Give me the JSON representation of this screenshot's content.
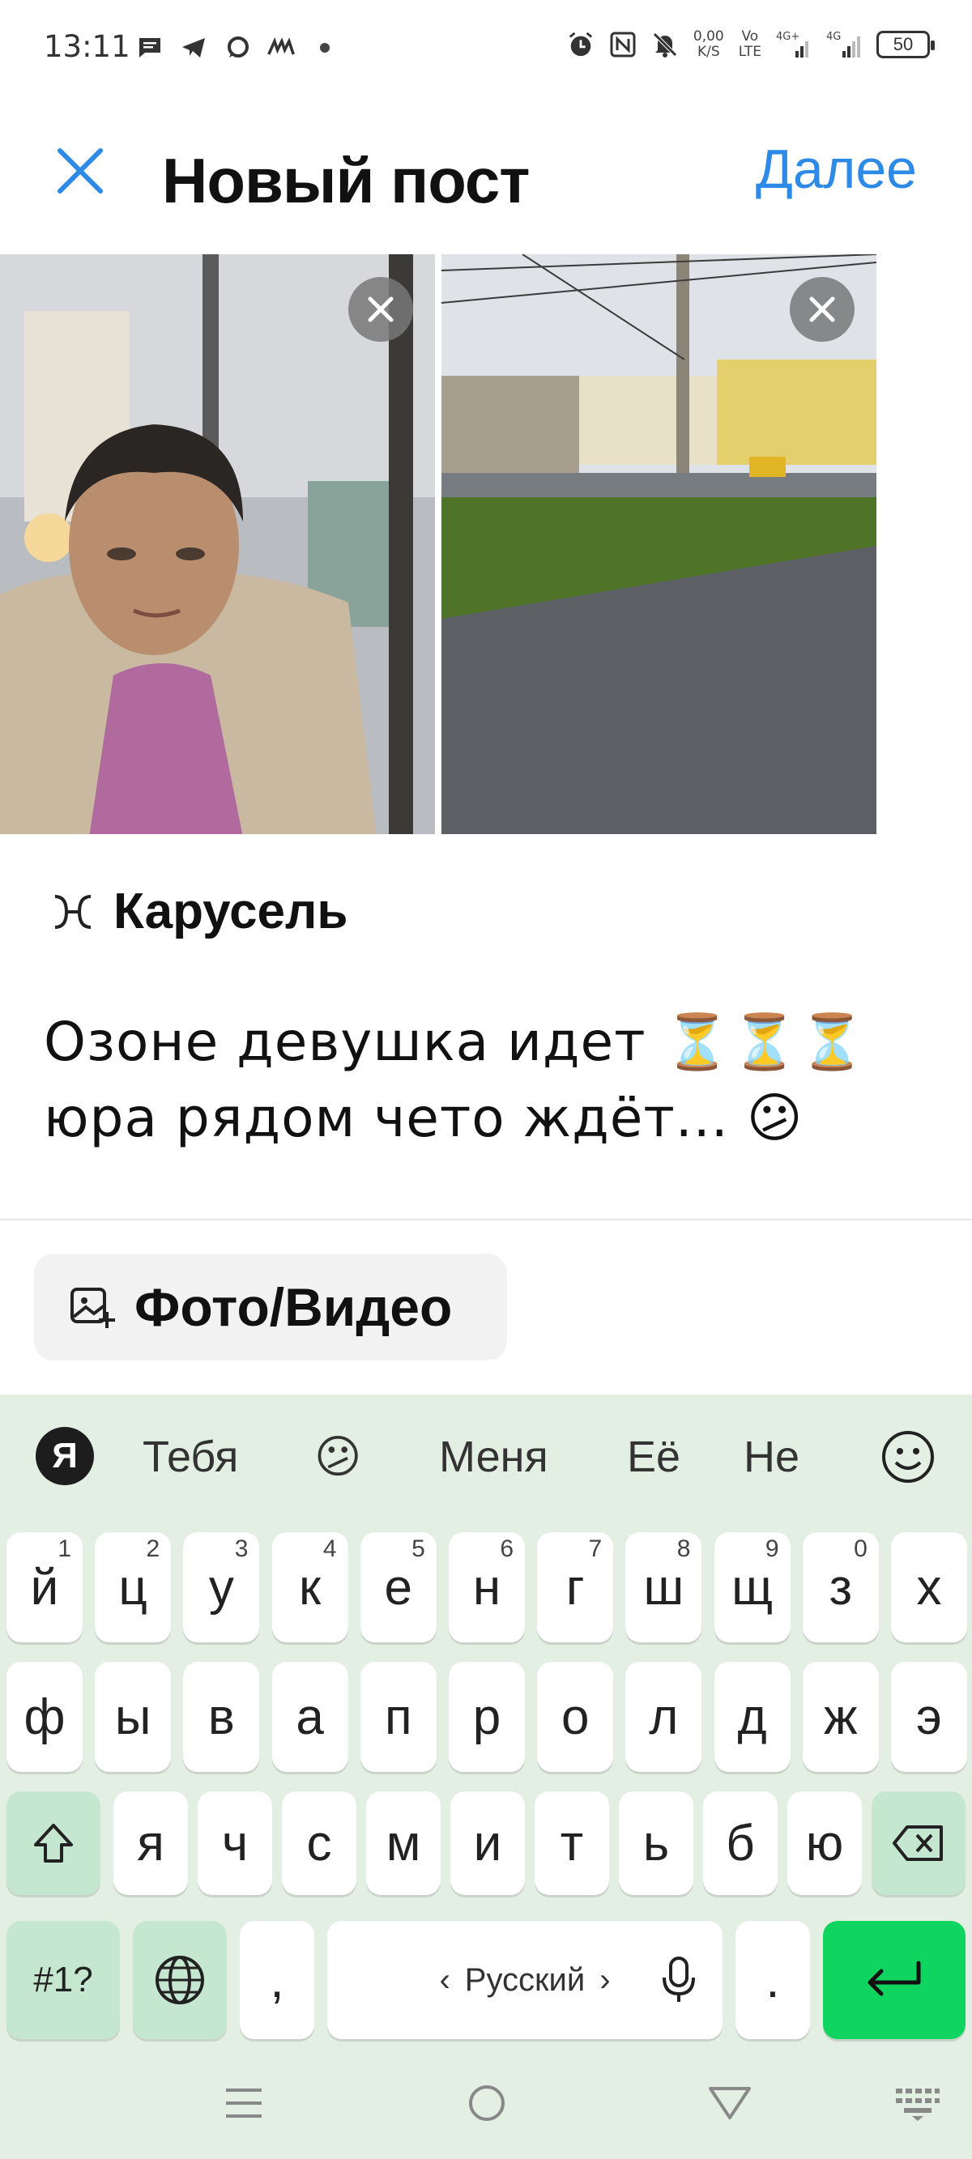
{
  "status_bar": {
    "time": "13:11",
    "net_speed_value": "0,00",
    "net_speed_unit": "K/S",
    "volte_top": "Vo",
    "volte_bottom": "LTE",
    "signal_1_label": "4G+",
    "signal_2_label": "4G",
    "battery": "50"
  },
  "header": {
    "title": "Новый пост",
    "next_label": "Далее"
  },
  "media": {
    "carousel_label": "Карусель",
    "add_media_label": "Фото/Видео"
  },
  "caption": {
    "line1": "Озоне девушка идет ⏳⏳⏳",
    "line2": "юра рядом чето ждёт... 😕"
  },
  "keyboard": {
    "suggestions": [
      "Тебя",
      "Меня",
      "Её",
      "Не"
    ],
    "suggestion_emoji": "😕",
    "ya_logo": "Я",
    "row1": [
      {
        "k": "й",
        "n": "1"
      },
      {
        "k": "ц",
        "n": "2"
      },
      {
        "k": "у",
        "n": "3"
      },
      {
        "k": "к",
        "n": "4"
      },
      {
        "k": "е",
        "n": "5"
      },
      {
        "k": "н",
        "n": "6"
      },
      {
        "k": "г",
        "n": "7"
      },
      {
        "k": "ш",
        "n": "8"
      },
      {
        "k": "щ",
        "n": "9"
      },
      {
        "k": "з",
        "n": "0"
      },
      {
        "k": "х",
        "n": ""
      }
    ],
    "row2": [
      "ф",
      "ы",
      "в",
      "а",
      "п",
      "р",
      "о",
      "л",
      "д",
      "ж",
      "э"
    ],
    "row3": [
      "я",
      "ч",
      "с",
      "м",
      "и",
      "т",
      "ь",
      "б",
      "ю"
    ],
    "symbols_label": "#1?",
    "comma": ",",
    "period": ".",
    "space_label": "Русский",
    "space_left_arrow": "‹",
    "space_right_arrow": "›"
  },
  "colors": {
    "accent": "#2d8ae6",
    "keyboard_bg": "#e3efe3",
    "func_key": "#c5e7d0",
    "enter_key": "#0fd45f"
  }
}
